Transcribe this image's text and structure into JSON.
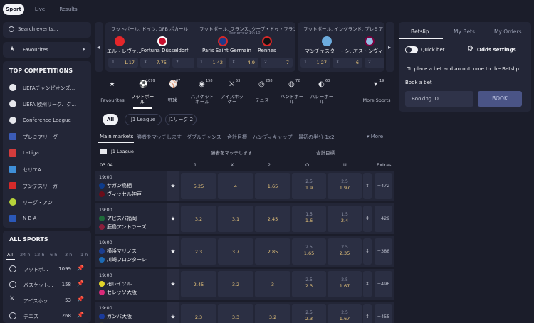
{
  "topnav": {
    "tabs": [
      "Sport",
      "Live",
      "Results"
    ]
  },
  "sidebar": {
    "search_placeholder": "Search events...",
    "favourites": "Favourites",
    "top_title": "TOP COMPETITIONS",
    "competitions": [
      "UEFAチャンピオンズ...",
      "UEFA 欧州リーグ、グ...",
      "Conference League",
      "プレミアリーグ",
      "LaLiga",
      "セリエA",
      "ブンデスリーガ",
      "リーグ・アン",
      "N B A"
    ],
    "all_title": "ALL SPORTS",
    "time_tabs": [
      "All",
      "24 h",
      "12 h",
      "6 h",
      "3 h",
      "1 h"
    ],
    "sports": [
      {
        "name": "フットボ...",
        "count": "1099"
      },
      {
        "name": "バスケット...",
        "count": "158"
      },
      {
        "name": "アイスホッ...",
        "count": "53"
      },
      {
        "name": "テニス",
        "count": "268"
      }
    ]
  },
  "featured": [
    {
      "comp": "フットボール. ドイツ. DFB ポカール",
      "time": "",
      "home": "エル・レヴァ...",
      "away": "Fortuna Düsseldorf",
      "odds": [
        [
          "1",
          "1.17"
        ],
        [
          "X",
          "7.75"
        ],
        [
          "2",
          "15"
        ]
      ]
    },
    {
      "comp": "フットボール. フランス. クープ・ドゥ・フランス",
      "time": "Tomorrow 19:10",
      "home": "Paris Saint Germain",
      "away": "Rennes",
      "odds": [
        [
          "1",
          "1.42"
        ],
        [
          "X",
          "4.9"
        ],
        [
          "2",
          "7"
        ]
      ]
    },
    {
      "comp": "フットボール. イングランド. プレミアリ...",
      "time": "",
      "home": "マンチェスター・シ...",
      "away": "アストンヴィ",
      "odds": [
        [
          "1",
          "1.27"
        ],
        [
          "X",
          "6"
        ],
        [
          "2",
          ""
        ]
      ]
    }
  ],
  "sport_tabs": [
    {
      "name": "Favourites",
      "count": ""
    },
    {
      "name": "フットボー\nル",
      "count": "1099"
    },
    {
      "name": "野球",
      "count": "67"
    },
    {
      "name": "バスケット\nボール",
      "count": "158"
    },
    {
      "name": "アイスホッ\nケー",
      "count": "53"
    },
    {
      "name": "テニス",
      "count": "268"
    },
    {
      "name": "ハンドボー\nル",
      "count": "72"
    },
    {
      "name": "バレーボー\nル",
      "count": "63"
    },
    {
      "name": "",
      "count": ""
    },
    {
      "name": "More Sports",
      "count": "19"
    }
  ],
  "leagues": [
    "All",
    "J1 League",
    "J1リーグ 2"
  ],
  "market_tabs": [
    "Main markets",
    "勝者をマッチします",
    "ダブルチャンス",
    "合計目標",
    "ハンディキャップ",
    "最初の半分-1x2",
    "More"
  ],
  "table": {
    "league": "J1 League",
    "group1": "勝者をマッチします",
    "group2": "合計目標",
    "date": "03.04",
    "cols": [
      "1",
      "X",
      "2",
      "O",
      "U",
      "Extras"
    ]
  },
  "matches": [
    {
      "time": "19:00",
      "home": "サガン鳥栖",
      "away": "ヴィッセル神戸",
      "o1": "5.25",
      "ox": "4",
      "o2": "1.65",
      "ol": "2.5",
      "ov": "1.9",
      "ul": "2.5",
      "uv": "1.97",
      "extras": "+472"
    },
    {
      "time": "19:00",
      "home": "アビスパ福岡",
      "away": "鹿島アントラーズ",
      "o1": "3.2",
      "ox": "3.1",
      "o2": "2.45",
      "ol": "1.5",
      "ov": "1.6",
      "ul": "1.5",
      "uv": "2.4",
      "extras": "+429"
    },
    {
      "time": "19:00",
      "home": "横浜マリノス",
      "away": "川崎フロンターレ",
      "o1": "2.3",
      "ox": "3.7",
      "o2": "2.85",
      "ol": "2.5",
      "ov": "1.65",
      "ul": "2.5",
      "uv": "2.35",
      "extras": "+388"
    },
    {
      "time": "19:00",
      "home": "柏レイソル",
      "away": "セレッソ大阪",
      "o1": "2.45",
      "ox": "3.2",
      "o2": "3",
      "ol": "2.5",
      "ov": "2.3",
      "ul": "2.5",
      "uv": "1.67",
      "extras": "+496"
    },
    {
      "time": "19:00",
      "home": "ガンバ大阪",
      "away": "",
      "o1": "2.3",
      "ox": "3.3",
      "o2": "3.2",
      "ol": "2.5",
      "ov": "2.3",
      "ul": "2.5",
      "uv": "1.67",
      "extras": "+455"
    }
  ],
  "betslip": {
    "tabs": [
      "Betslip",
      "My Bets",
      "My Orders"
    ],
    "quick_bet": "Quick bet",
    "odds_settings": "Odds settings",
    "message": "To place a bet add an outcome to the Betslip",
    "book_title": "Book a bet",
    "booking_placeholder": "Booking ID",
    "book_button": "BOOK"
  },
  "icons": {
    "search": "search-icon",
    "star": "star-icon",
    "ball": "football-icon",
    "pin": "pin-icon",
    "gear": "gear-icon"
  },
  "colors": {
    "bg": "#1b1d2a",
    "panel": "#232637",
    "odds": "#e9c67b",
    "book": "#4a5486"
  }
}
